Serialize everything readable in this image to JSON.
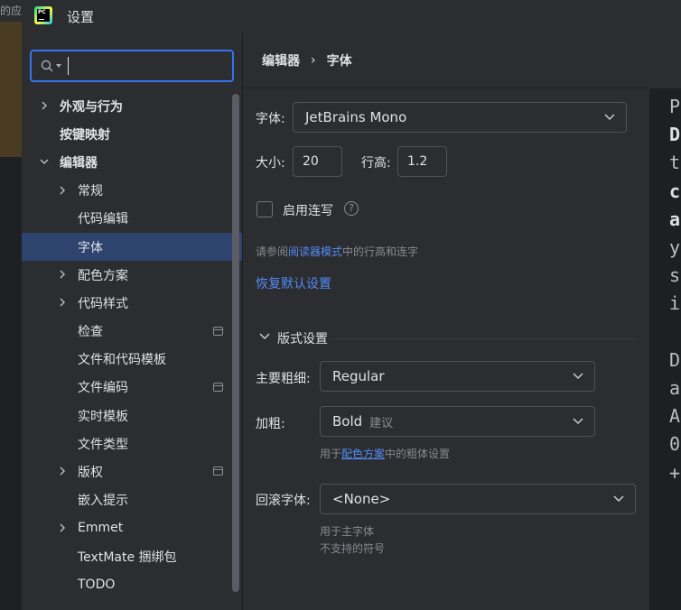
{
  "background_app": {
    "fragment_text": "的应"
  },
  "window": {
    "title": "设置"
  },
  "search": {
    "value": "",
    "placeholder": ""
  },
  "sidebar": {
    "items": [
      {
        "label": "外观与行为",
        "level": 0,
        "expandable": true,
        "expanded": false,
        "bold": true
      },
      {
        "label": "按键映射",
        "level": 0,
        "expandable": false,
        "bold": true
      },
      {
        "label": "编辑器",
        "level": 0,
        "expandable": true,
        "expanded": true,
        "bold": true
      },
      {
        "label": "常规",
        "level": 1,
        "expandable": true,
        "expanded": false
      },
      {
        "label": "代码编辑",
        "level": 1,
        "expandable": false
      },
      {
        "label": "字体",
        "level": 1,
        "expandable": false,
        "selected": true
      },
      {
        "label": "配色方案",
        "level": 1,
        "expandable": true,
        "expanded": false
      },
      {
        "label": "代码样式",
        "level": 1,
        "expandable": true,
        "expanded": false
      },
      {
        "label": "检查",
        "level": 1,
        "expandable": false,
        "modified_icon": true
      },
      {
        "label": "文件和代码模板",
        "level": 1,
        "expandable": false
      },
      {
        "label": "文件编码",
        "level": 1,
        "expandable": false,
        "modified_icon": true
      },
      {
        "label": "实时模板",
        "level": 1,
        "expandable": false
      },
      {
        "label": "文件类型",
        "level": 1,
        "expandable": false
      },
      {
        "label": "版权",
        "level": 1,
        "expandable": true,
        "expanded": false,
        "modified_icon": true
      },
      {
        "label": "嵌入提示",
        "level": 1,
        "expandable": false
      },
      {
        "label": "Emmet",
        "level": 1,
        "expandable": true,
        "expanded": false
      },
      {
        "label": "TextMate 捆绑包",
        "level": 1,
        "expandable": false
      },
      {
        "label": "TODO",
        "level": 1,
        "expandable": false
      }
    ]
  },
  "breadcrumb": {
    "parent": "编辑器",
    "separator": "›",
    "current": "字体"
  },
  "font": {
    "font_label": "字体:",
    "font_value": "JetBrains Mono",
    "size_label": "大小:",
    "size_value": "20",
    "line_height_label": "行高:",
    "line_height_value": "1.2",
    "ligatures_label": "启用连写",
    "ligatures_checked": false,
    "help_glyph": "?",
    "reader_note_prefix": "请参阅",
    "reader_note_link": "阅读器模式",
    "reader_note_suffix": "中的行高和连字",
    "restore_defaults": "恢复默认设置"
  },
  "typography": {
    "section_title": "版式设置",
    "main_weight_label": "主要粗细:",
    "main_weight_value": "Regular",
    "bold_label": "加粗:",
    "bold_value": "Bold",
    "bold_hint": "建议",
    "bold_note_prefix": "用于",
    "bold_note_link": "配色方案",
    "bold_note_suffix": "中的粗体设置",
    "fallback_label": "回滚字体:",
    "fallback_value": "<None>",
    "fallback_note_line1": "用于主字体",
    "fallback_note_line2": "不支持的符号"
  },
  "preview": {
    "lines": [
      {
        "text": "P",
        "bold": false
      },
      {
        "text": "D",
        "bold": true
      },
      {
        "text": "t",
        "bold": false
      },
      {
        "text": "c",
        "bold": true
      },
      {
        "text": "a",
        "bold": true
      },
      {
        "text": "y",
        "bold": false
      },
      {
        "text": "s",
        "bold": false
      },
      {
        "text": "i",
        "bold": false
      },
      {
        "text": "",
        "bold": false
      },
      {
        "text": "D",
        "bold": false
      },
      {
        "text": "a",
        "bold": false
      },
      {
        "text": "A",
        "bold": false
      },
      {
        "text": "0",
        "bold": false
      },
      {
        "text": "+",
        "bold": false
      }
    ]
  },
  "colors": {
    "accent": "#3574f0",
    "selection": "#2e436e",
    "link": "#548af7",
    "panel": "#2b2d30",
    "editor_bg": "#1e1f22"
  }
}
